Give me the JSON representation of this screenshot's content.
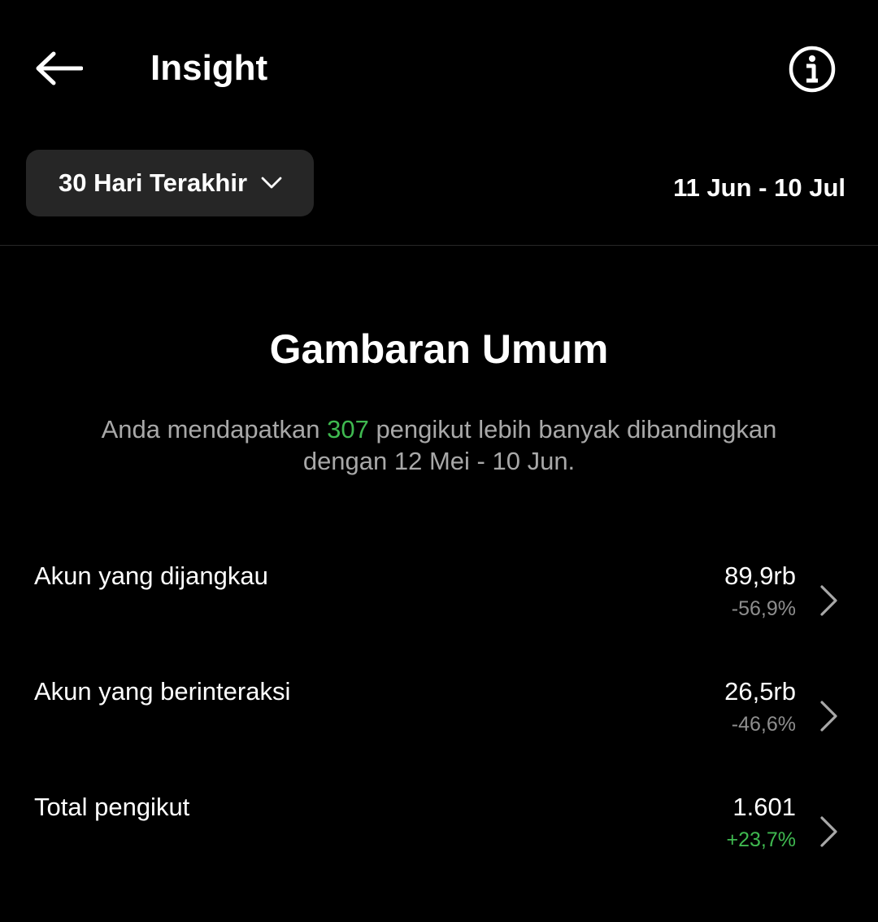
{
  "header": {
    "title": "Insight",
    "back_icon": "arrow-left-icon",
    "info_icon": "info-circle-icon"
  },
  "filter": {
    "period_label": "30 Hari Terakhir",
    "dropdown_icon": "chevron-down-icon",
    "date_range": "11 Jun - 10 Jul"
  },
  "overview": {
    "title": "Gambaran Umum",
    "summary_prefix": "Anda mendapatkan ",
    "summary_highlight": "307",
    "summary_suffix": " pengikut lebih banyak dibandingkan dengan 12 Mei - 10 Jun."
  },
  "metrics": [
    {
      "label": "Akun yang dijangkau",
      "value": "89,9rb",
      "change": "-56,9%",
      "trend": "negative"
    },
    {
      "label": "Akun yang berinteraksi",
      "value": "26,5rb",
      "change": "-46,6%",
      "trend": "negative"
    },
    {
      "label": "Total pengikut",
      "value": "1.601",
      "change": "+23,7%",
      "trend": "positive"
    }
  ],
  "colors": {
    "background": "#000000",
    "dropdown_bg": "#262626",
    "muted_text": "#a8a8a8",
    "change_muted": "#8e8e8e",
    "positive": "#3fb950"
  }
}
